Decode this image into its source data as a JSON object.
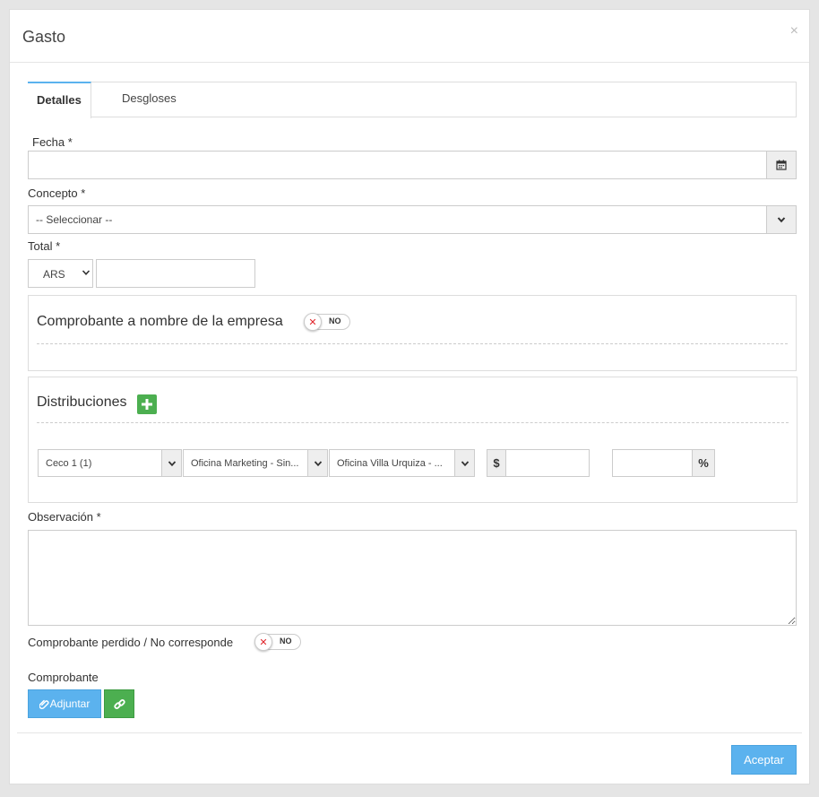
{
  "modal": {
    "title": "Gasto",
    "close_glyph": "×"
  },
  "tabs": [
    {
      "label": "Detalles",
      "active": true
    },
    {
      "label": "Desgloses",
      "active": false
    }
  ],
  "fecha": {
    "label": "Fecha *",
    "value": "",
    "icon": "calendar-icon"
  },
  "concepto": {
    "label": "Concepto *",
    "selected": "-- Seleccionar --"
  },
  "total": {
    "label": "Total *",
    "currency": "ARS",
    "amount": ""
  },
  "comprobante_empresa": {
    "title": "Comprobante a nombre de la empresa",
    "toggle": "NO"
  },
  "distribuciones": {
    "title": "Distribuciones",
    "row": {
      "ceco": "Ceco 1 (1)",
      "oficina1": "Oficina Marketing - Sin...",
      "oficina2": "Oficina Villa Urquiza - ...",
      "currency_symbol": "$",
      "amount": "",
      "percent": "",
      "percent_symbol": "%"
    }
  },
  "observacion": {
    "label": "Observación *",
    "value": ""
  },
  "comprobante_perdido": {
    "label": "Comprobante perdido / No corresponde",
    "toggle": "NO"
  },
  "comprobante": {
    "label": "Comprobante",
    "adjuntar": "Adjuntar"
  },
  "footer": {
    "accept": "Aceptar"
  },
  "colors": {
    "accent": "#5bb2ee",
    "green": "#4caf50",
    "toggle_x": "#e0252b"
  }
}
